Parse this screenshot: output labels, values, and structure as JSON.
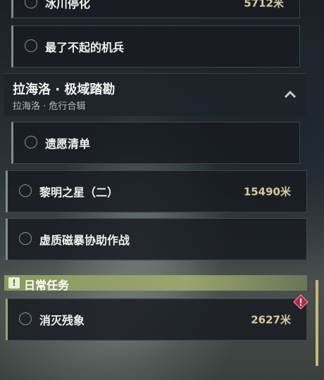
{
  "quests": {
    "top_partial": {
      "label": "冰川停化",
      "distance": "5712米"
    },
    "ace_pilot": {
      "label": "最了不起的机兵"
    },
    "section": {
      "title": "拉海洛 · 极域踏勘",
      "subtitle": "拉海洛 · 危行合辑"
    },
    "wish_list": {
      "label": "遗愿清单"
    },
    "dawn_star": {
      "label": "黎明之星（二）",
      "distance": "15490米"
    },
    "void_storm": {
      "label": "虚质磁暴协助作战"
    }
  },
  "daily": {
    "badge": "!",
    "title": "日常任务",
    "items": [
      {
        "label": "消灭残象",
        "distance": "2627米"
      }
    ]
  },
  "colors": {
    "accent_gold": "#d8c9a0",
    "daily_green": "#9aa56c",
    "warning_red": "#b32a45"
  }
}
